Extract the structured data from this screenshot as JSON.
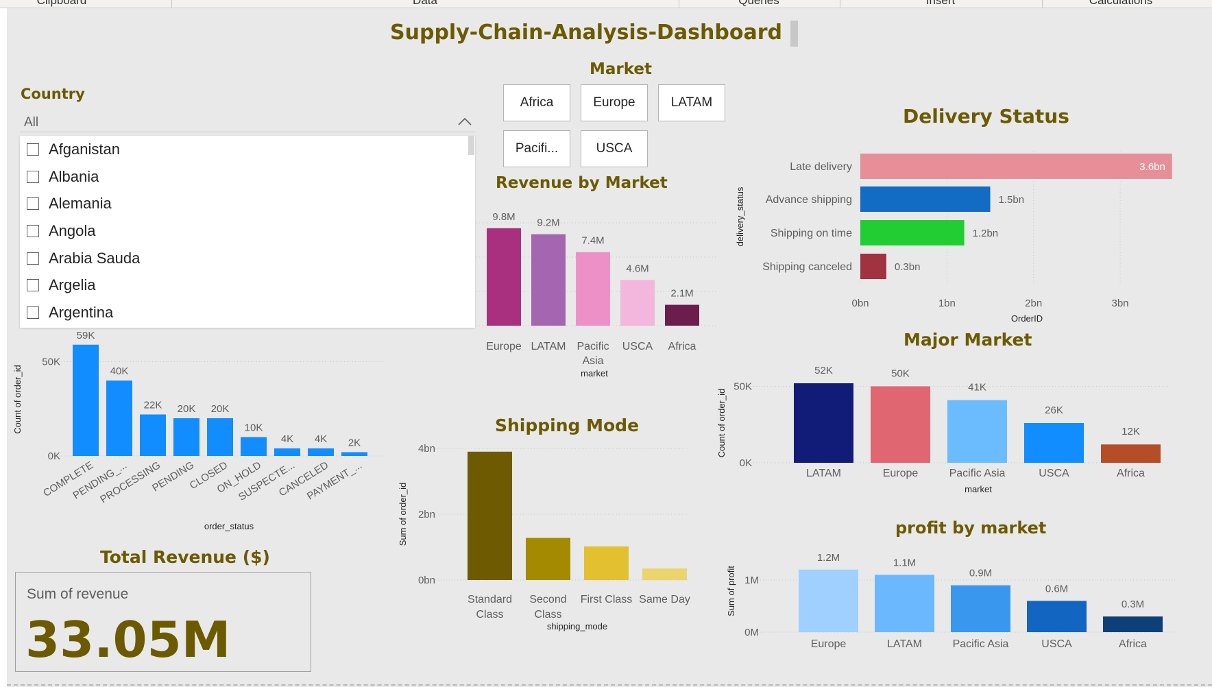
{
  "ribbon": {
    "groups": [
      "Clipboard",
      "Data",
      "Queries",
      "Insert",
      "Calculations"
    ]
  },
  "dashboard": {
    "title": "Supply-Chain-Analysis-Dashboard"
  },
  "country_slicer": {
    "title": "Country",
    "selected": "All",
    "items": [
      "Afganistan",
      "Albania",
      "Alemania",
      "Angola",
      "Arabia Sauda",
      "Argelia",
      "Argentina"
    ]
  },
  "market_slicer": {
    "title": "Market",
    "buttons": [
      "Africa",
      "Europe",
      "LATAM",
      "Pacifi...",
      "USCA"
    ]
  },
  "colors": {
    "canvas_bg": "#e9e9e9",
    "title_olive": "#6b5a00",
    "accent_blue": "#118dff"
  },
  "kpi": {
    "title": "Total Revenue ($)",
    "label": "Sum of revenue",
    "value": "33.05M"
  },
  "chart_data": [
    {
      "id": "order_status",
      "type": "bar",
      "title": "",
      "xlabel": "order_status",
      "ylabel": "Count of order_id",
      "categories": [
        "COMPLETE",
        "PENDING_...",
        "PROCESSING",
        "PENDING",
        "CLOSED",
        "ON_HOLD",
        "SUSPECTE...",
        "CANCELED",
        "PAYMENT_..."
      ],
      "values": [
        59000,
        40000,
        22000,
        20000,
        20000,
        10000,
        4000,
        4000,
        2000
      ],
      "data_labels": [
        "59K",
        "40K",
        "22K",
        "20K",
        "20K",
        "10K",
        "4K",
        "4K",
        "2K"
      ],
      "yticks": [
        "0K",
        "50K"
      ],
      "ylim": [
        0,
        60000
      ],
      "color": "#118dff"
    },
    {
      "id": "revenue_by_market",
      "type": "bar",
      "title": "Revenue by Market",
      "xlabel": "market",
      "ylabel": "",
      "categories": [
        "Europe",
        "LATAM",
        "Pacific Asia",
        "USCA",
        "Africa"
      ],
      "values": [
        9.8,
        9.2,
        7.4,
        4.6,
        2.1
      ],
      "data_labels": [
        "9.8M",
        "9.2M",
        "7.4M",
        "4.6M",
        "2.1M"
      ],
      "ylim": [
        0,
        10
      ],
      "colors": [
        "#a8307e",
        "#a566b1",
        "#ee90c8",
        "#f3b6dc",
        "#6b1e4e"
      ]
    },
    {
      "id": "delivery_status",
      "type": "bar",
      "orientation": "horizontal",
      "title": "Delivery Status",
      "xlabel": "OrderID",
      "ylabel": "delivery_status",
      "categories": [
        "Late delivery",
        "Advance shipping",
        "Shipping on time",
        "Shipping canceled"
      ],
      "values": [
        3.6,
        1.5,
        1.2,
        0.3
      ],
      "data_labels": [
        "3.6bn",
        "1.5bn",
        "1.2bn",
        "0.3bn"
      ],
      "xticks": [
        "0bn",
        "1bn",
        "2bn",
        "3bn"
      ],
      "xlim": [
        0,
        3.6
      ],
      "colors": [
        "#e78f99",
        "#126cc4",
        "#22cc33",
        "#a0333f"
      ]
    },
    {
      "id": "major_market",
      "type": "bar",
      "title": "Major Market",
      "xlabel": "market",
      "ylabel": "Count of order_id",
      "categories": [
        "LATAM",
        "Europe",
        "Pacific Asia",
        "USCA",
        "Africa"
      ],
      "values": [
        52000,
        50000,
        41000,
        26000,
        12000
      ],
      "data_labels": [
        "52K",
        "50K",
        "41K",
        "26K",
        "12K"
      ],
      "yticks": [
        "0K",
        "50K"
      ],
      "ylim": [
        0,
        52000
      ],
      "colors": [
        "#111c78",
        "#e06672",
        "#6bbcff",
        "#118dff",
        "#b54d28"
      ]
    },
    {
      "id": "shipping_mode",
      "type": "bar",
      "title": "Shipping Mode",
      "xlabel": "shipping_mode",
      "ylabel": "Sum of order_id",
      "categories": [
        "Standard Class",
        "Second Class",
        "First Class",
        "Same Day"
      ],
      "values": [
        3.9,
        1.28,
        1.02,
        0.35
      ],
      "yticks": [
        "0bn",
        "2bn",
        "4bn"
      ],
      "ylim": [
        0,
        4
      ],
      "colors": [
        "#6e5a00",
        "#a38a00",
        "#e2c02f",
        "#ecd46c"
      ]
    },
    {
      "id": "profit_by_market",
      "type": "bar",
      "title": "profit by market",
      "xlabel": "",
      "ylabel": "Sum of profit",
      "categories": [
        "Europe",
        "LATAM",
        "Pacific Asia",
        "USCA",
        "Africa"
      ],
      "values": [
        1.2,
        1.1,
        0.9,
        0.6,
        0.3
      ],
      "data_labels": [
        "1.2M",
        "1.1M",
        "0.9M",
        "0.6M",
        "0.3M"
      ],
      "yticks": [
        "0M",
        "1M"
      ],
      "ylim": [
        0,
        1.2
      ],
      "colors": [
        "#9fd0ff",
        "#6bb8ff",
        "#3a97ee",
        "#1265c0",
        "#0d3f78"
      ]
    }
  ]
}
